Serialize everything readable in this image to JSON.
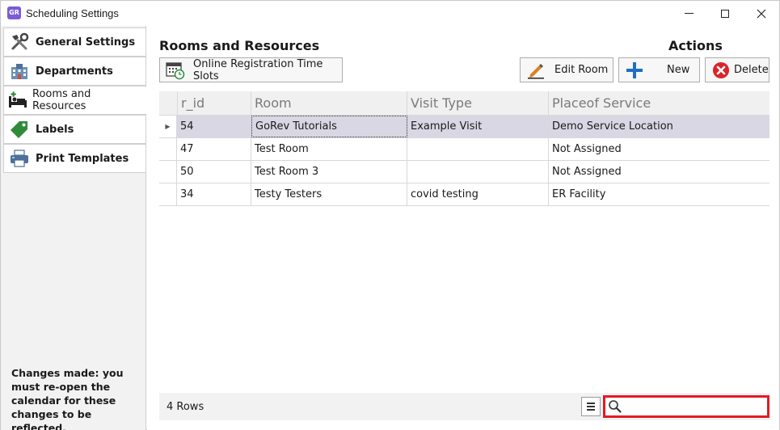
{
  "window": {
    "title": "Scheduling Settings",
    "app_icon_text": "GoRev"
  },
  "sidebar": {
    "items": [
      {
        "label": "General Settings",
        "icon": "tools-icon"
      },
      {
        "label": "Departments",
        "icon": "building-icon"
      },
      {
        "label": "Rooms and Resources",
        "icon": "bed-icon",
        "active": true
      },
      {
        "label": "Labels",
        "icon": "tag-icon"
      },
      {
        "label": "Print Templates",
        "icon": "printer-icon"
      }
    ],
    "note": "Changes made: you must re-open the calendar for these changes to be reflected."
  },
  "main": {
    "section_title": "Rooms and Resources",
    "actions_title": "Actions",
    "buttons": {
      "online_registration": "Online Registration Time Slots",
      "edit_room": "Edit Room",
      "new": "New",
      "delete": "Delete"
    },
    "grid": {
      "columns": [
        "r_id",
        "Room",
        "Visit Type",
        "Placeof Service"
      ],
      "rows": [
        {
          "r_id": "54",
          "room": "GoRev Tutorials",
          "visit_type": "Example Visit",
          "place": "Demo Service Location",
          "selected": true
        },
        {
          "r_id": "47",
          "room": "Test Room",
          "visit_type": "",
          "place": "Not Assigned"
        },
        {
          "r_id": "50",
          "room": "Test Room 3",
          "visit_type": "",
          "place": "Not Assigned"
        },
        {
          "r_id": "34",
          "room": "Testy Testers",
          "visit_type": "covid testing",
          "place": "ER Facility"
        }
      ]
    },
    "footer": {
      "rows_count": "4 Rows",
      "search_value": ""
    }
  },
  "colors": {
    "selected_row": "#d9d7e4",
    "search_highlight": "#e21b24",
    "new_plus": "#1f6fc5",
    "delete_red": "#d9252a",
    "app_icon": "#7b5bd6"
  }
}
